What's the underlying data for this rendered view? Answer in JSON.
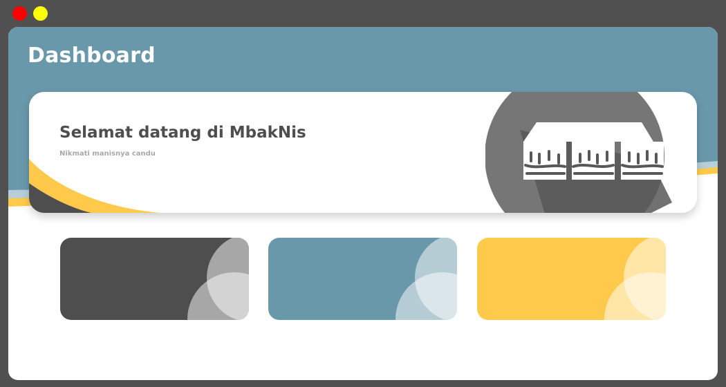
{
  "window": {
    "controls": [
      "close-dot",
      "minimize-dot"
    ],
    "control_colors": [
      "#ff0000",
      "#ffff00"
    ]
  },
  "header": {
    "title": "Dashboard"
  },
  "hero": {
    "title": "Selamat datang di MbakNis",
    "subtitle": "Nikmati manisnya candu",
    "logo_icon": "market-stall-icon"
  },
  "cards": [
    {
      "color": "#4e4e4e"
    },
    {
      "color": "#6a98ab"
    },
    {
      "color": "#ffca4c"
    }
  ],
  "theme": {
    "frame": "#505050",
    "header": "#6a98ab",
    "accent": "#ffca4c",
    "dark": "#4e4e4e"
  }
}
